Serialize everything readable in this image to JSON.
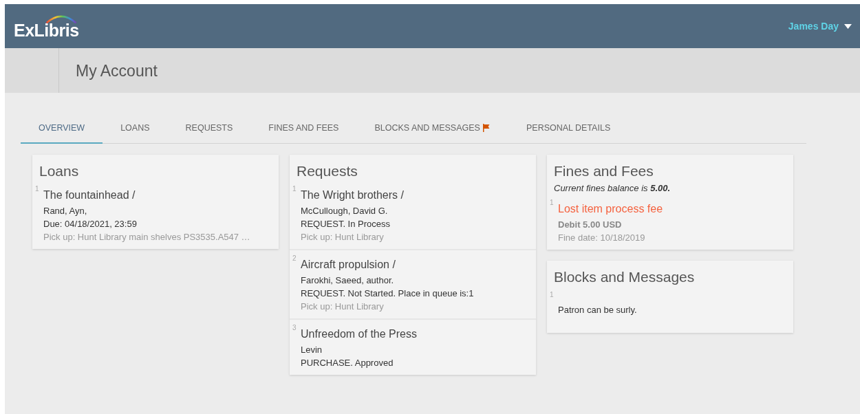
{
  "header": {
    "logo": "ExLibris",
    "user": "James Day"
  },
  "page_title": "My Account",
  "tabs": [
    {
      "label": "OVERVIEW",
      "selected": true,
      "flag": false
    },
    {
      "label": "LOANS",
      "selected": false,
      "flag": false
    },
    {
      "label": "REQUESTS",
      "selected": false,
      "flag": false
    },
    {
      "label": "FINES AND FEES",
      "selected": false,
      "flag": false
    },
    {
      "label": "BLOCKS AND MESSAGES",
      "selected": false,
      "flag": true
    },
    {
      "label": "PERSONAL DETAILS",
      "selected": false,
      "flag": false
    }
  ],
  "loans": {
    "title": "Loans",
    "items": [
      {
        "number": "1",
        "title": "The fountainhead /",
        "lines": [
          {
            "kind": "text",
            "text": "Rand, Ayn,"
          },
          {
            "kind": "text",
            "text": "Due: 04/18/2021, 23:59"
          },
          {
            "kind": "muted",
            "text": "Pick up: Hunt Library main shelves PS3535.A547 …"
          }
        ]
      }
    ]
  },
  "requests": {
    "title": "Requests",
    "items": [
      {
        "number": "1",
        "title": "The Wright brothers /",
        "lines": [
          {
            "kind": "text",
            "text": "McCullough, David G."
          },
          {
            "kind": "text",
            "text": "REQUEST. In Process"
          },
          {
            "kind": "muted",
            "text": "Pick up: Hunt Library"
          }
        ]
      },
      {
        "number": "2",
        "title": "Aircraft propulsion /",
        "lines": [
          {
            "kind": "text",
            "text": "Farokhi, Saeed, author."
          },
          {
            "kind": "text",
            "text": "REQUEST. Not Started. Place in queue is:1"
          },
          {
            "kind": "muted",
            "text": "Pick up: Hunt Library"
          }
        ]
      },
      {
        "number": "3",
        "title": "Unfreedom of the Press",
        "lines": [
          {
            "kind": "text",
            "text": "Levin"
          },
          {
            "kind": "text",
            "text": "PURCHASE. Approved"
          }
        ]
      }
    ]
  },
  "fines": {
    "title": "Fines and Fees",
    "balance": "Current fines balance is **5.00.**",
    "items": [
      {
        "number": "1",
        "title": "Lost item process fee",
        "lines": [
          {
            "kind": "strong",
            "text": "Debit 5.00 USD"
          },
          {
            "kind": "muted",
            "text": "Fine date: 10/18/2019"
          }
        ]
      }
    ]
  },
  "blocks": {
    "title": "Blocks and Messages",
    "items": [
      {
        "number": "1",
        "text": "Patron can be surly."
      }
    ]
  }
}
